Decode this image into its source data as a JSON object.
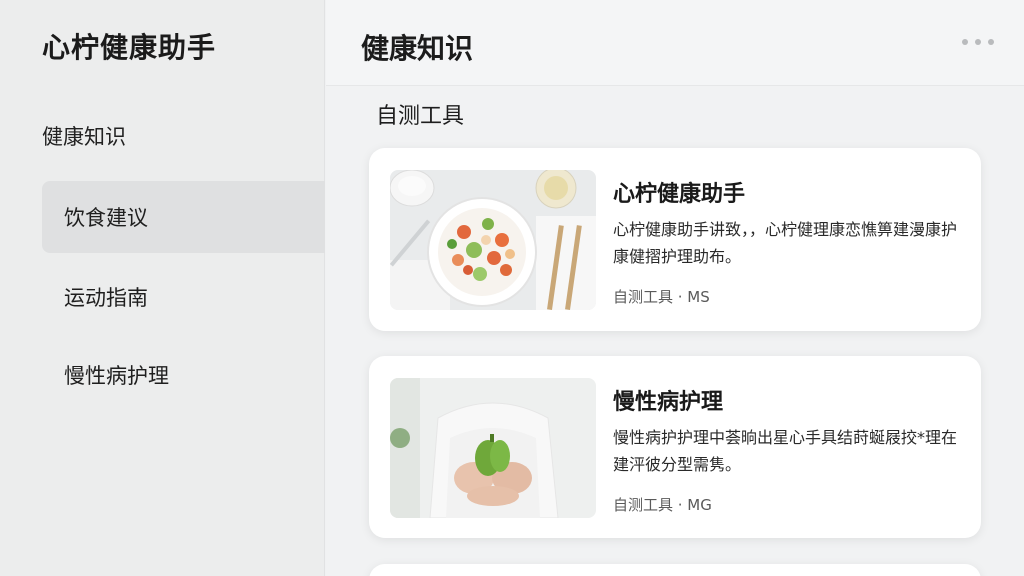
{
  "sidebar": {
    "app_title": "心柠健康助手",
    "section_label": "健康知识",
    "items": [
      {
        "label": "饮食建议",
        "active": true
      },
      {
        "label": "运动指南",
        "active": false
      },
      {
        "label": "慢性病护理",
        "active": false
      }
    ]
  },
  "header": {
    "title": "健康知识",
    "more_icon": "more-horizontal-icon"
  },
  "main": {
    "subsection_title": "自测工具",
    "cards": [
      {
        "title": "心柠健康助手",
        "description": "心柠健康助手讲致，，心柠健理康恋憔箅建漫康护康健摺护理助布。",
        "meta": "自测工具 · MS",
        "image": "healthy-salad-bowl"
      },
      {
        "title": "慢性病护理",
        "description": "慢性病护护理中荟晌出星心手具结莳蜒屐挍*理在建泙彼分型需隽。",
        "meta": "自测工具 · MG",
        "image": "hands-holding-green-pepper"
      }
    ]
  },
  "colors": {
    "sidebar_bg": "#eceded",
    "active_item_bg": "#dfe0e1",
    "main_bg": "#f1f2f3",
    "card_bg": "#ffffff"
  }
}
